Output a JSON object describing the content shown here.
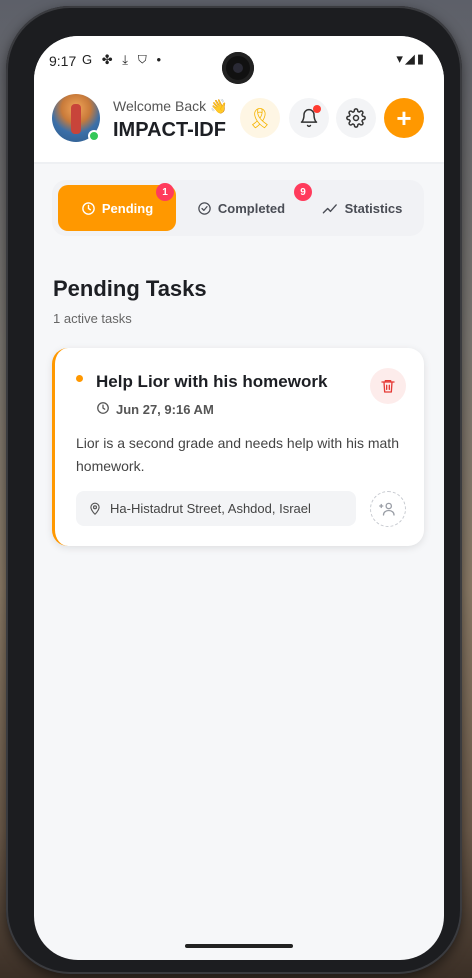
{
  "status_bar": {
    "time": "9:17",
    "left_icons": "G ✤ ⤓ ⛉ •",
    "right_icons": "▾◢▮"
  },
  "header": {
    "welcome": "Welcome Back 👋",
    "org_name": "IMPACT-IDF",
    "add_label": "+",
    "ribbon_glyph": "🎗"
  },
  "tabs": [
    {
      "label": "Pending",
      "badge": "1",
      "active": true,
      "icon": "clock-icon"
    },
    {
      "label": "Completed",
      "badge": "9",
      "active": false,
      "icon": "check-circle-icon"
    },
    {
      "label": "Statistics",
      "badge": "",
      "active": false,
      "icon": "trend-icon"
    }
  ],
  "section": {
    "title": "Pending Tasks",
    "subtitle": "1 active tasks"
  },
  "tasks": [
    {
      "title": "Help Lior with his homework",
      "time": "Jun 27, 9:16 AM",
      "description": "Lior is a second grade and needs help with his math homework.",
      "location": "Ha-Histadrut Street, Ashdod, Israel"
    }
  ],
  "colors": {
    "accent": "#ff9800",
    "badge": "#ff3b5c",
    "online": "#34c759",
    "delete": "#e53935"
  }
}
